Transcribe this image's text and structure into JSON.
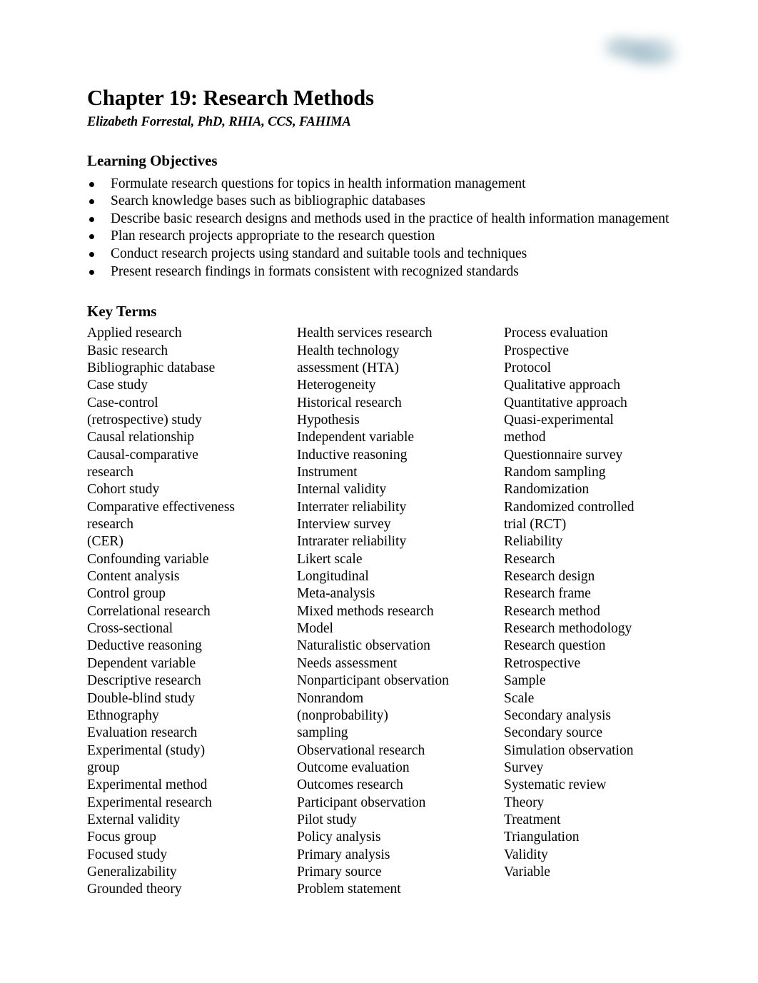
{
  "document": {
    "chapter_title": "Chapter 19: Research Methods",
    "author": "Elizabeth Forrestal, PhD, RHIA, CCS, FAHIMA"
  },
  "learning_objectives": {
    "heading": "Learning Objectives",
    "items": [
      "Formulate research questions for topics in health information management",
      "Search knowledge bases such as bibliographic databases",
      "Describe basic research designs and methods used in the practice of health information management",
      "Plan research projects appropriate to the research question",
      "Conduct research projects using standard and suitable tools and techniques",
      "Present research findings in formats consistent with recognized standards"
    ]
  },
  "key_terms": {
    "heading": "Key Terms",
    "columns": [
      [
        "Applied research",
        "Basic research",
        "Bibliographic database",
        "Case study",
        "Case-control",
        "(retrospective) study",
        "Causal relationship",
        "Causal-comparative",
        "research",
        "Cohort study",
        "Comparative effectiveness",
        "research",
        "(CER)",
        "Confounding variable",
        "Content analysis",
        "Control group",
        "Correlational research",
        "Cross-sectional",
        "Deductive reasoning",
        "Dependent variable",
        "Descriptive research",
        "Double-blind study",
        "Ethnography",
        "Evaluation research",
        "Experimental (study)",
        "group",
        "Experimental method",
        "Experimental research",
        "External validity",
        "Focus group",
        "Focused study",
        "Generalizability",
        "Grounded theory"
      ],
      [
        "Health services research",
        "Health technology",
        "assessment (HTA)",
        "Heterogeneity",
        "Historical research",
        "Hypothesis",
        "Independent variable",
        "Inductive reasoning",
        "Instrument",
        "Internal validity",
        "Interrater reliability",
        "Interview survey",
        "Intrarater reliability",
        "Likert scale",
        "Longitudinal",
        "Meta-analysis",
        "Mixed methods research",
        "Model",
        "Naturalistic observation",
        "Needs assessment",
        "Nonparticipant observation",
        "Nonrandom",
        "(nonprobability)",
        "sampling",
        "Observational research",
        "Outcome evaluation",
        "Outcomes research",
        "Participant observation",
        "Pilot study",
        "Policy analysis",
        "Primary analysis",
        "Primary source",
        "Problem statement"
      ],
      [
        "Process evaluation",
        "Prospective",
        "Protocol",
        "Qualitative approach",
        "Quantitative approach",
        "Quasi-experimental",
        "method",
        "Questionnaire survey",
        "Random sampling",
        "Randomization",
        "Randomized controlled",
        "trial (RCT)",
        "Reliability",
        "Research",
        "Research design",
        "Research frame",
        "Research method",
        "Research methodology",
        "Research question",
        "Retrospective",
        "Sample",
        "Scale",
        "Secondary analysis",
        "Secondary source",
        "Simulation observation",
        "Survey",
        "Systematic review",
        "Theory",
        "Treatment",
        "Triangulation",
        "Validity",
        "Variable"
      ]
    ]
  },
  "decoration": {
    "watermark_color": "#9cbac6"
  }
}
